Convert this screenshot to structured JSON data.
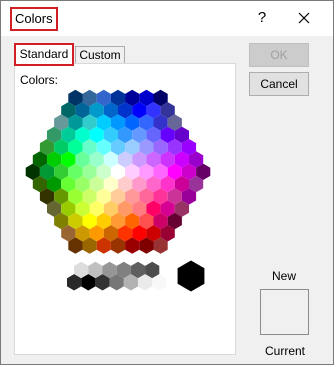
{
  "window": {
    "title": "Colors",
    "help": "?"
  },
  "tabs": [
    {
      "label": "Standard"
    },
    {
      "label": "Custom"
    }
  ],
  "panel": {
    "colors_label": "Colors:"
  },
  "buttons": {
    "ok": "OK",
    "cancel": "Cancel"
  },
  "preview": {
    "new_label": "New",
    "current_label": "Current"
  },
  "palette": {
    "rows": [
      [
        "#003366",
        "#336699",
        "#3366CC",
        "#003399",
        "#000099",
        "#0000CC",
        "#000066"
      ],
      [
        "#006666",
        "#006699",
        "#0099CC",
        "#0066CC",
        "#0033CC",
        "#0000FF",
        "#3333FF",
        "#333399"
      ],
      [
        "#669999",
        "#009999",
        "#33CCCC",
        "#00CCFF",
        "#0099FF",
        "#0066FF",
        "#3366FF",
        "#3333CC",
        "#666699"
      ],
      [
        "#339966",
        "#00CC99",
        "#00FFCC",
        "#00FFFF",
        "#33CCFF",
        "#3399FF",
        "#6699FF",
        "#6666FF",
        "#6600FF",
        "#6600CC"
      ],
      [
        "#339933",
        "#00CC66",
        "#00FF99",
        "#66FFCC",
        "#66FFFF",
        "#66CCFF",
        "#99CCFF",
        "#9999FF",
        "#9966FF",
        "#9933FF",
        "#9900FF"
      ],
      [
        "#006600",
        "#00CC00",
        "#00FF00",
        "#66FF99",
        "#99FFCC",
        "#CCFFFF",
        "#CCCCFF",
        "#CC99FF",
        "#CC66FF",
        "#CC33FF",
        "#CC00FF",
        "#9900CC"
      ],
      [
        "#003300",
        "#009933",
        "#33CC33",
        "#66FF66",
        "#99FF99",
        "#CCFFCC",
        "#FFFFFF",
        "#FFCCFF",
        "#FF99FF",
        "#FF66FF",
        "#FF00FF",
        "#CC00CC",
        "#660066"
      ],
      [
        "#336600",
        "#009900",
        "#66FF33",
        "#99FF66",
        "#CCFF99",
        "#FFFFCC",
        "#FFCCCC",
        "#FF99CC",
        "#FF66CC",
        "#FF33CC",
        "#CC0099",
        "#993399"
      ],
      [
        "#333300",
        "#669900",
        "#99FF33",
        "#CCFF66",
        "#FFFF99",
        "#FFCC99",
        "#FF9999",
        "#FF6699",
        "#FF3399",
        "#CC3399",
        "#990099"
      ],
      [
        "#666633",
        "#99CC00",
        "#CCFF33",
        "#FFFF66",
        "#FFCC66",
        "#FF9966",
        "#FF7C80",
        "#FF0066",
        "#D60093",
        "#993366"
      ],
      [
        "#808000",
        "#CCCC00",
        "#FFFF00",
        "#FFCC00",
        "#FF9933",
        "#FF6600",
        "#FF5050",
        "#CC0066",
        "#660033"
      ],
      [
        "#996633",
        "#CC9900",
        "#FF9900",
        "#CC6600",
        "#FF3300",
        "#FF0000",
        "#CC0000",
        "#990033"
      ],
      [
        "#663300",
        "#996600",
        "#CC3300",
        "#993300",
        "#990000",
        "#800000",
        "#993333"
      ]
    ],
    "grays": [
      "#FFFFFF",
      "#DDDDDD",
      "#C0C0C0",
      "#969696",
      "#808080",
      "#5F5F5F",
      "#4D4D4D",
      "#292929",
      "#000000",
      "#333333",
      "#777777",
      "#B2B2B2",
      "#EAEAEA",
      "#F8F8F8"
    ],
    "black": "#000000"
  }
}
